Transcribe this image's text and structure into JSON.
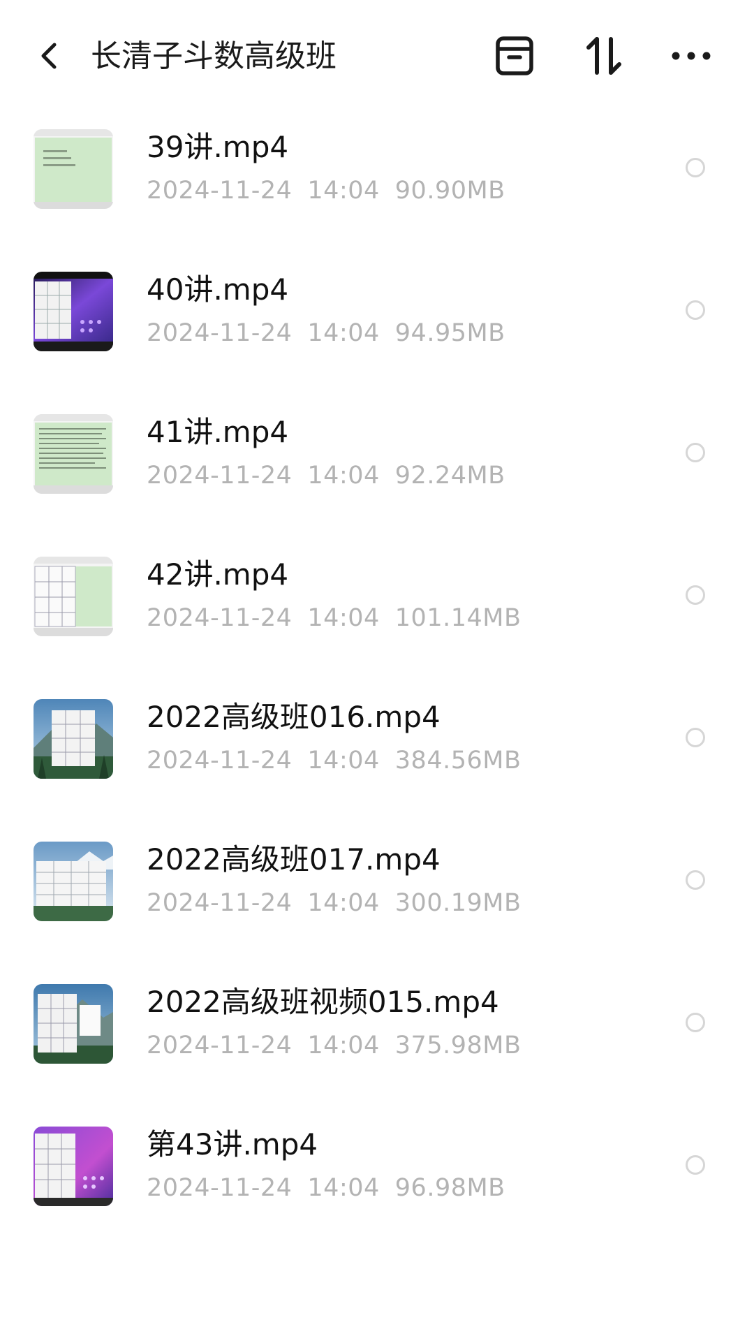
{
  "header": {
    "title": "长清子斗数高级班",
    "back_icon": "chevron-left-icon",
    "archive_icon": "archive-box-icon",
    "sort_icon": "sort-arrows-icon",
    "more_icon": "more-horizontal-icon"
  },
  "files": [
    {
      "name": "39讲.mp4",
      "date": "2024-11-24",
      "time": "14:04",
      "size": "90.90MB",
      "thumb": "green-doc"
    },
    {
      "name": "40讲.mp4",
      "date": "2024-11-24",
      "time": "14:04",
      "size": "94.95MB",
      "thumb": "purple-desktop"
    },
    {
      "name": "41讲.mp4",
      "date": "2024-11-24",
      "time": "14:04",
      "size": "92.24MB",
      "thumb": "green-doc"
    },
    {
      "name": "42讲.mp4",
      "date": "2024-11-24",
      "time": "14:04",
      "size": "101.14MB",
      "thumb": "chart-green"
    },
    {
      "name": "2022高级班016.mp4",
      "date": "2024-11-24",
      "time": "14:04",
      "size": "384.56MB",
      "thumb": "landscape"
    },
    {
      "name": "2022高级班017.mp4",
      "date": "2024-11-24",
      "time": "14:04",
      "size": "300.19MB",
      "thumb": "landscape-light"
    },
    {
      "name": "2022高级班视频015.mp4",
      "date": "2024-11-24",
      "time": "14:04",
      "size": "375.98MB",
      "thumb": "landscape"
    },
    {
      "name": "第43讲.mp4",
      "date": "2024-11-24",
      "time": "14:04",
      "size": "96.98MB",
      "thumb": "purple-desktop"
    }
  ],
  "colors": {
    "meta_text": "#b3b3b3",
    "circle_border": "#d6d6d6",
    "doc_green": "#cfe9c9",
    "desktop_purple": "#6b3fc2"
  }
}
